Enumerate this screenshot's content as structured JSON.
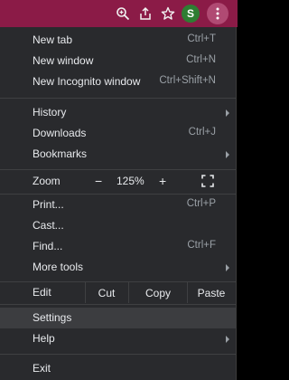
{
  "menu": {
    "section1": [
      {
        "label": "New tab",
        "shortcut": "Ctrl+T"
      },
      {
        "label": "New window",
        "shortcut": "Ctrl+N"
      },
      {
        "label": "New Incognito window",
        "shortcut": "Ctrl+Shift+N"
      }
    ],
    "history": {
      "label": "History"
    },
    "downloads": {
      "label": "Downloads",
      "shortcut": "Ctrl+J"
    },
    "bookmarks": {
      "label": "Bookmarks"
    },
    "zoom": {
      "label": "Zoom",
      "minus": "−",
      "value": "125%",
      "plus": "+"
    },
    "print": {
      "label": "Print...",
      "shortcut": "Ctrl+P"
    },
    "cast": {
      "label": "Cast..."
    },
    "find": {
      "label": "Find...",
      "shortcut": "Ctrl+F"
    },
    "more_tools": {
      "label": "More tools"
    },
    "edit": {
      "label": "Edit",
      "cut": "Cut",
      "copy": "Copy",
      "paste": "Paste"
    },
    "settings": {
      "label": "Settings"
    },
    "help": {
      "label": "Help"
    },
    "exit": {
      "label": "Exit"
    }
  },
  "profile": {
    "initial": "S"
  },
  "colors": {
    "titlebar": "#8b1b47",
    "menu_bg": "#292a2d",
    "highlight": "#3c3d40",
    "avatar": "#2e7d32"
  },
  "icons": [
    "zoom-icon",
    "share-icon",
    "star-icon",
    "avatar",
    "more-vert-icon",
    "fullscreen-icon",
    "chevron-right-icon"
  ]
}
